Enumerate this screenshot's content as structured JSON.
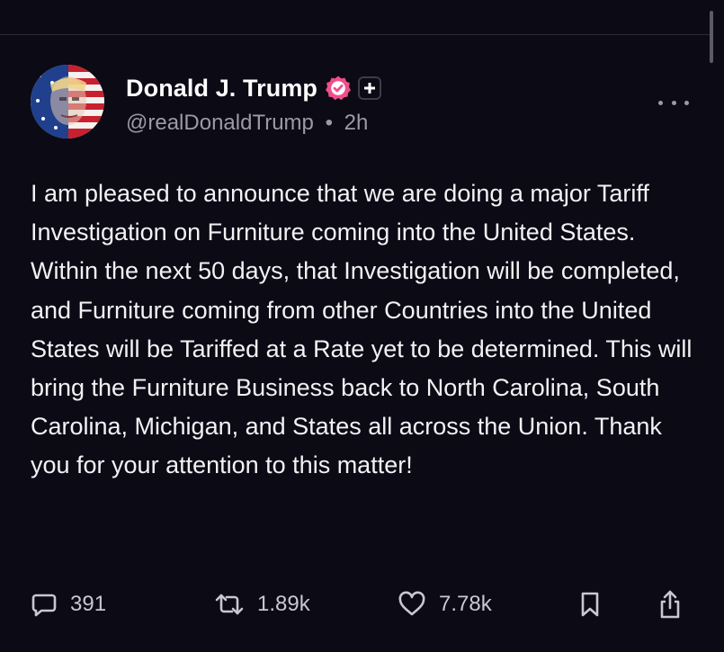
{
  "colors": {
    "background": "#0b0a15",
    "verified_badge": "#ef4e8a",
    "muted_text": "#9b9aa6",
    "body_text": "#f2f2f5"
  },
  "post": {
    "author": {
      "display_name": "Donald J. Trump",
      "handle": "@realDonaldTrump",
      "separator": "•",
      "time_ago": "2h",
      "verified_icon": "verified-badge-icon",
      "plus_icon": "plus-icon"
    },
    "text": "I am pleased to announce that we are doing a major Tariff Investigation on Furniture coming into the United States. Within the next 50 days, that Investigation will be completed, and Furniture coming from other Countries into the United States will be Tariffed at a Rate yet to be determined. This will bring the Furniture Business back to North Carolina, South Carolina, Michigan, and States all across the Union. Thank you for your attention to this matter!",
    "stats": {
      "replies": "391",
      "reposts": "1.89k",
      "likes": "7.78k"
    }
  }
}
